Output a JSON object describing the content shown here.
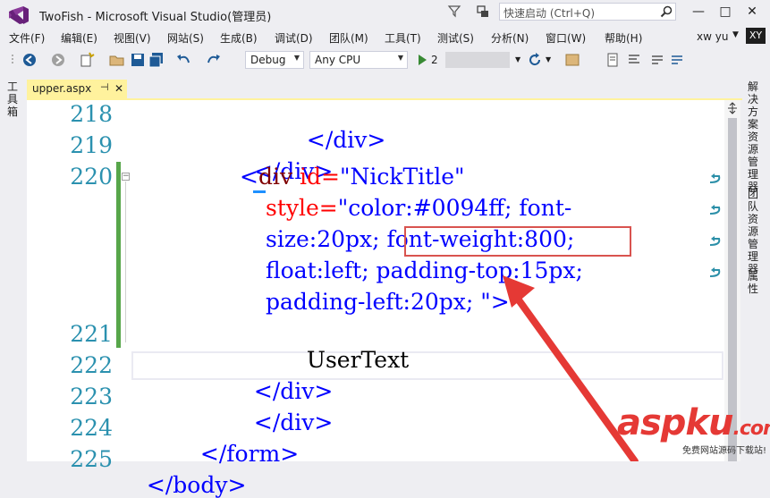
{
  "window": {
    "title": "TwoFish - Microsoft Visual Studio(管理员)",
    "quick_launch_placeholder": "快速启动 (Ctrl+Q)",
    "minimize": "—",
    "restore": "□",
    "close": "✕"
  },
  "menu": [
    "文件(F)",
    "编辑(E)",
    "视图(V)",
    "网站(S)",
    "生成(B)",
    "调试(D)",
    "团队(M)",
    "工具(T)",
    "测试(S)",
    "分析(N)",
    "窗口(W)",
    "帮助(H)"
  ],
  "user": {
    "name": "xw yu",
    "initials": "XY"
  },
  "toolbar": {
    "configuration": "Debug",
    "platform": "Any CPU",
    "start_prefix": "2"
  },
  "side_tabs": {
    "left": "工具箱",
    "right": [
      "解决方案资源管理器",
      "团队资源管理器",
      "属性"
    ]
  },
  "document_tab": {
    "label": "upper.aspx",
    "pin": "⊣"
  },
  "code": {
    "line_numbers": [
      "218",
      "219",
      "220",
      "221",
      "222",
      "223",
      "224",
      "225"
    ],
    "lines": [
      {
        "tag_text": "</div>"
      },
      {
        "tag_text": "</div>"
      },
      {
        "open": "<",
        "tag": "div",
        "attr": " id=",
        "val": "\"NickTitle\""
      },
      {
        "attr": "style=",
        "val": "\"color:#0094ff; font-"
      },
      {
        "text": "size:20px; ",
        "hl": "font-weight:800;"
      },
      {
        "text": "float:left; padding-top:15px;"
      },
      {
        "text": "padding-left:20px; ",
        "close": "\">"
      },
      {
        "inner": "UserText"
      },
      {
        "tag_text": "</div>"
      },
      {
        "tag_text": "</div>"
      },
      {
        "tag_text": "</form>"
      },
      {
        "tag_text": "</body>"
      }
    ]
  },
  "watermark": {
    "logo": "aspku",
    "suffix": ".com",
    "tagline": "免费网站源码下载站!"
  },
  "colors": {
    "accent_purple": "#68217a",
    "tab_yellow": "#fff29d",
    "line_number": "#2b91af",
    "tag": "#800000",
    "attribute": "#ff0000",
    "value": "#0000ff",
    "change_bar": "#57a64a",
    "highlight_box": "#d9534f",
    "arrow": "#e53935"
  }
}
